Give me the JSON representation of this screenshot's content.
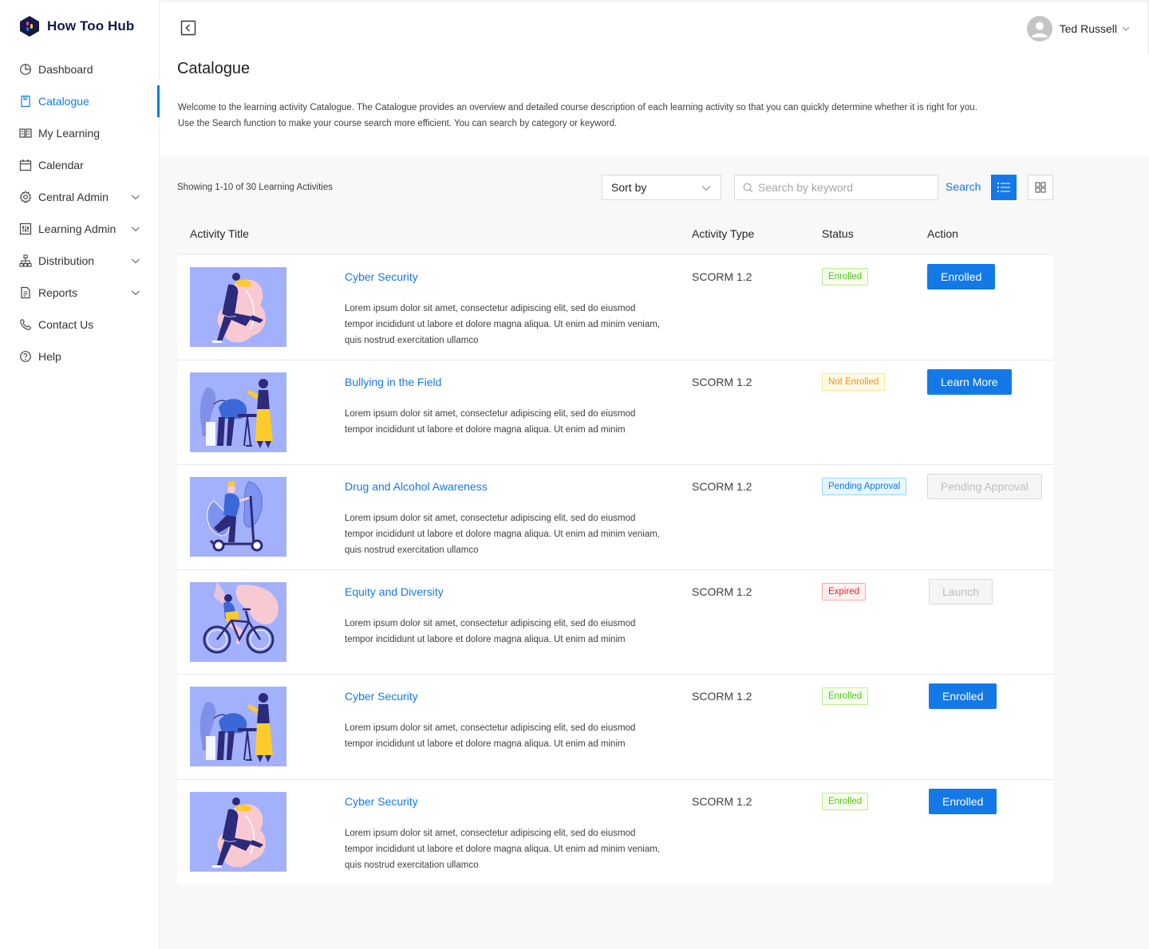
{
  "brand": {
    "name": "How Too Hub"
  },
  "sidebar": {
    "items": [
      {
        "label": "Dashboard",
        "icon": "dashboard-icon",
        "active": false,
        "expandable": false
      },
      {
        "label": "Catalogue",
        "icon": "catalogue-icon",
        "active": true,
        "expandable": false
      },
      {
        "label": "My Learning",
        "icon": "book-icon",
        "active": false,
        "expandable": false
      },
      {
        "label": "Calendar",
        "icon": "calendar-icon",
        "active": false,
        "expandable": false
      },
      {
        "label": "Central Admin",
        "icon": "gear-icon",
        "active": false,
        "expandable": true
      },
      {
        "label": "Learning Admin",
        "icon": "sliders-icon",
        "active": false,
        "expandable": true
      },
      {
        "label": "Distribution",
        "icon": "hierarchy-icon",
        "active": false,
        "expandable": true
      },
      {
        "label": "Reports",
        "icon": "report-icon",
        "active": false,
        "expandable": true
      },
      {
        "label": "Contact Us",
        "icon": "phone-icon",
        "active": false,
        "expandable": false
      },
      {
        "label": "Help",
        "icon": "help-icon",
        "active": false,
        "expandable": false
      }
    ]
  },
  "header": {
    "user_name": "Ted Russell"
  },
  "page": {
    "title": "Catalogue",
    "description_line1": "Welcome to the learning activity Catalogue. The Catalogue provides an overview and detailed course description of each learning activity so that you can quickly determine whether it is right for you.",
    "description_line2": "Use the Search function to make your course search more efficient. You can search by category or keyword."
  },
  "toolbar": {
    "showing": "Showing 1-10 of 30 Learning Activities",
    "sort_label": "Sort by",
    "search_placeholder": "Search by keyword",
    "search_label": "Search"
  },
  "table": {
    "columns": [
      "Activity Title",
      "Activity Type",
      "Status",
      "Action"
    ],
    "rows": [
      {
        "title": "Cyber Security",
        "type": "SCORM 1.2",
        "status": "Enrolled",
        "status_kind": "enrolled",
        "action": "Enrolled",
        "action_kind": "primary",
        "image": "runner-illustration",
        "lines": 3,
        "description": "Lorem ipsum dolor sit amet, consectetur adipiscing elit, sed do eiusmod tempor incididunt ut labore et dolore magna aliqua. Ut enim ad minim veniam, quis nostrud exercitation ullamco"
      },
      {
        "title": "Bullying in the Field",
        "type": "SCORM 1.2",
        "status": "Not Enrolled",
        "status_kind": "notenrolled",
        "action": "Learn More",
        "action_kind": "primary",
        "image": "office-illustration",
        "lines": 2,
        "description": "Lorem ipsum dolor sit amet, consectetur adipiscing elit, sed do eiusmod tempor incididunt ut labore et dolore magna aliqua. Ut enim ad minim"
      },
      {
        "title": "Drug and Alcohol Awareness",
        "type": "SCORM 1.2",
        "status": "Pending Approval",
        "status_kind": "pending",
        "action": "Pending Approval",
        "action_kind": "disabled",
        "image": "scooter-illustration",
        "lines": 3,
        "description": "Lorem ipsum dolor sit amet, consectetur adipiscing elit, sed do eiusmod tempor incididunt ut labore et dolore magna aliqua. Ut enim ad minim veniam, quis nostrud exercitation ullamco"
      },
      {
        "title": "Equity and Diversity",
        "type": "SCORM 1.2",
        "status": "Expired",
        "status_kind": "expired",
        "action": "Launch",
        "action_kind": "disabled",
        "image": "bicycle-illustration",
        "lines": 2,
        "description": "Lorem ipsum dolor sit amet, consectetur adipiscing elit, sed do eiusmod tempor incididunt ut labore et dolore magna aliqua. Ut enim ad minim"
      },
      {
        "title": "Cyber Security",
        "type": "SCORM 1.2",
        "status": "Enrolled",
        "status_kind": "enrolled",
        "action": "Enrolled",
        "action_kind": "primary",
        "image": "office-illustration",
        "lines": 2,
        "description": "Lorem ipsum dolor sit amet, consectetur adipiscing elit, sed do eiusmod tempor incididunt ut labore et dolore magna aliqua. Ut enim ad minim"
      },
      {
        "title": "Cyber Security",
        "type": "SCORM 1.2",
        "status": "Enrolled",
        "status_kind": "enrolled",
        "action": "Enrolled",
        "action_kind": "primary",
        "image": "runner-illustration",
        "lines": 3,
        "description": "Lorem ipsum dolor sit amet, consectetur adipiscing elit, sed do eiusmod tempor incididunt ut labore et dolore magna aliqua. Ut enim ad minim veniam, quis nostrud exercitation ullamco"
      }
    ]
  },
  "colors": {
    "primary": "#1479e6",
    "thumb_bg": "#a3b0fb",
    "brand_dark": "#141a45"
  }
}
